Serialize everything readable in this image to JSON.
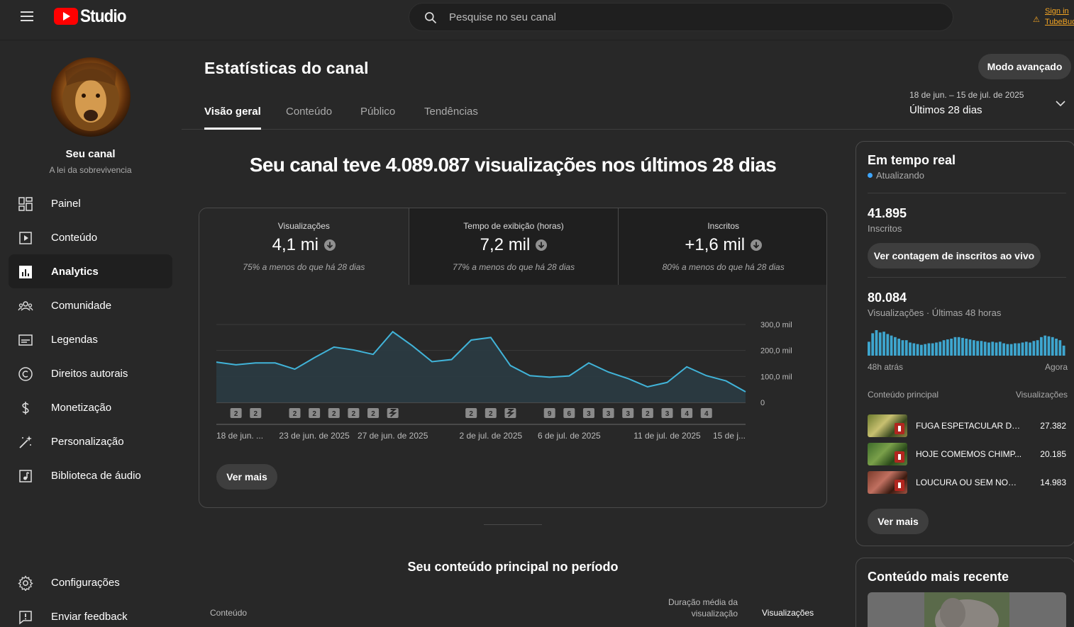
{
  "header": {
    "logo_text": "Studio",
    "search_placeholder": "Pesquise no seu canal",
    "signin_line1": "Sign in",
    "signin_line2": "TubeBuddy"
  },
  "sidebar": {
    "channel_label": "Seu canal",
    "channel_name": "A lei da sobrevivencia",
    "items": [
      {
        "label": "Painel",
        "icon": "dashboard-icon"
      },
      {
        "label": "Conteúdo",
        "icon": "content-icon"
      },
      {
        "label": "Analytics",
        "icon": "analytics-icon",
        "active": true
      },
      {
        "label": "Comunidade",
        "icon": "community-icon"
      },
      {
        "label": "Legendas",
        "icon": "subtitles-icon"
      },
      {
        "label": "Direitos autorais",
        "icon": "copyright-icon"
      },
      {
        "label": "Monetização",
        "icon": "dollar-icon"
      },
      {
        "label": "Personalização",
        "icon": "magic-wand-icon"
      },
      {
        "label": "Biblioteca de áudio",
        "icon": "audio-library-icon"
      }
    ],
    "bottom_items": [
      {
        "label": "Configurações",
        "icon": "gear-icon"
      },
      {
        "label": "Enviar feedback",
        "icon": "feedback-icon"
      }
    ]
  },
  "main": {
    "title": "Estatísticas do canal",
    "advanced_button": "Modo avançado",
    "tabs": [
      "Visão geral",
      "Conteúdo",
      "Público",
      "Tendências"
    ],
    "date_range": {
      "dates": "18 de jun. – 15 de jul. de 2025",
      "label": "Últimos 28 dias"
    },
    "headline": "Seu canal teve 4.089.087 visualizações nos últimos 28 dias",
    "kpis": [
      {
        "title": "Visualizações",
        "value": "4,1 mi",
        "sub": "75% a menos do que há 28 dias"
      },
      {
        "title": "Tempo de exibição (horas)",
        "value": "7,2 mil",
        "sub": "77% a menos do que há 28 dias"
      },
      {
        "title": "Inscritos",
        "value": "+1,6 mil",
        "sub": "80% a menos do que há 28 dias"
      }
    ],
    "see_more": "Ver mais",
    "top_content_title": "Seu conteúdo principal no período",
    "table_headers": {
      "content": "Conteúdo",
      "avg_duration_line1": "Duração média da",
      "avg_duration_line2": "visualização",
      "views": "Visualizações"
    }
  },
  "chart_data": {
    "type": "area",
    "ylim": [
      0,
      300000
    ],
    "y_ticks": [
      "300,0 mil",
      "200,0 mil",
      "100,0 mil",
      "0"
    ],
    "x_labels": [
      "18 de jun. ...",
      "23 de jun. de 2025",
      "27 de jun. de 2025",
      "2 de jul. de 2025",
      "6 de jul. de 2025",
      "11 de jul. de 2025",
      "15 de j..."
    ],
    "x_label_index": [
      0,
      5,
      9,
      14,
      18,
      23,
      27
    ],
    "values": [
      155000,
      145000,
      152000,
      152000,
      128000,
      172000,
      213000,
      202000,
      185000,
      272000,
      218000,
      157000,
      165000,
      240000,
      250000,
      142000,
      103000,
      97000,
      102000,
      152000,
      117000,
      92000,
      60000,
      77000,
      137000,
      103000,
      83000,
      41000
    ],
    "series_color": "#41b4d9",
    "markers": [
      {
        "i": 1,
        "label": "2"
      },
      {
        "i": 2,
        "label": "2"
      },
      {
        "i": 4,
        "label": "2"
      },
      {
        "i": 5,
        "label": "2"
      },
      {
        "i": 6,
        "label": "2"
      },
      {
        "i": 7,
        "label": "2"
      },
      {
        "i": 8,
        "label": "2"
      },
      {
        "i": 9,
        "label": "shorts"
      },
      {
        "i": 13,
        "label": "2"
      },
      {
        "i": 14,
        "label": "2"
      },
      {
        "i": 15,
        "label": "shorts"
      },
      {
        "i": 17,
        "label": "9"
      },
      {
        "i": 18,
        "label": "6"
      },
      {
        "i": 19,
        "label": "3"
      },
      {
        "i": 20,
        "label": "3"
      },
      {
        "i": 21,
        "label": "3"
      },
      {
        "i": 22,
        "label": "2"
      },
      {
        "i": 23,
        "label": "3"
      },
      {
        "i": 24,
        "label": "4"
      },
      {
        "i": 25,
        "label": "4"
      }
    ]
  },
  "realtime": {
    "title": "Em tempo real",
    "status": "Atualizando",
    "subs_value": "41.895",
    "subs_label": "Inscritos",
    "live_button": "Ver contagem de inscritos ao vivo",
    "views_value": "80.084",
    "views_label": "Visualizações · Últimas 48 horas",
    "spark_start": "48h atrás",
    "spark_end": "Agora",
    "spark": [
      18,
      29,
      33,
      30,
      31,
      28,
      26,
      24,
      22,
      20,
      20,
      17,
      16,
      15,
      14,
      15,
      16,
      16,
      17,
      18,
      20,
      21,
      22,
      24,
      24,
      23,
      22,
      21,
      20,
      19,
      19,
      18,
      17,
      18,
      17,
      18,
      16,
      15,
      15,
      16,
      16,
      17,
      18,
      17,
      19,
      20,
      24,
      26,
      25,
      24,
      22,
      20,
      13
    ],
    "top_header": "Conteúdo principal",
    "top_header_right": "Visualizações",
    "top_items": [
      {
        "title": "FUGA ESPETACULAR DE ...",
        "views": "27.382"
      },
      {
        "title": "HOJE COMEMOS CHIMP...",
        "views": "20.185"
      },
      {
        "title": "LOUCURA OU SEM NOÇÃO",
        "views": "14.983"
      }
    ],
    "see_more": "Ver mais"
  },
  "recent": {
    "title": "Conteúdo mais recente"
  }
}
